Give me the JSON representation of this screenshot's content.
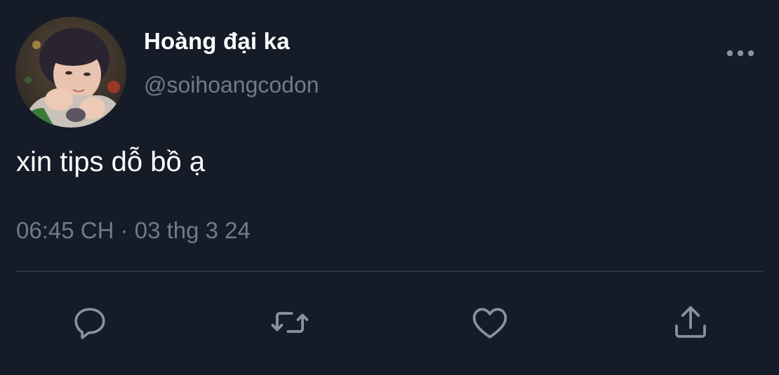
{
  "user": {
    "display_name": "Hoàng đại ka",
    "handle": "@soihoangcodon"
  },
  "tweet": {
    "text": "xin tips dỗ bồ ạ",
    "timestamp": "06:45 CH · 03 thg 3 24"
  },
  "icons": {
    "more": "more-horizontal-icon",
    "reply": "reply-icon",
    "retweet": "retweet-icon",
    "like": "heart-icon",
    "share": "share-icon"
  },
  "colors": {
    "background": "#151c28",
    "primary_text": "#ffffff",
    "secondary_text": "#6e7b8b",
    "divider": "#2c3643",
    "icon": "#8593a3"
  }
}
